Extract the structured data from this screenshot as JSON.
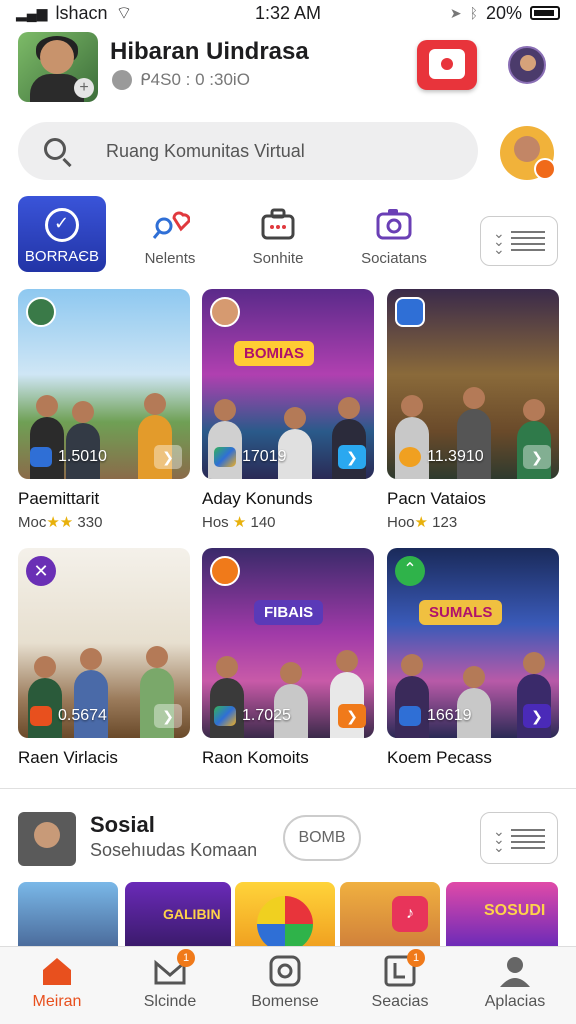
{
  "status_bar": {
    "carrier": "lshacn",
    "time": "1:32 AM",
    "battery": "20%"
  },
  "header": {
    "title": "Hibaran Uindrasa",
    "subtitle": "ᑭ4S0 : 0 :30iO"
  },
  "search": {
    "placeholder": "Ruang Komunitas Virtual"
  },
  "categories": [
    {
      "label": "BORRAЄB",
      "icon": "check-circle-icon",
      "active": true
    },
    {
      "label": "Nelents",
      "icon": "heart-pin-icon",
      "active": false
    },
    {
      "label": "Sonhite",
      "icon": "briefcase-icon",
      "active": false
    },
    {
      "label": "Sociatans",
      "icon": "camera-icon",
      "active": false
    }
  ],
  "cards": [
    {
      "title": "Paemittarit",
      "sub_prefix": "Moc",
      "rating": "★★",
      "sub_value": "330",
      "count": "1.5010",
      "sign": ""
    },
    {
      "title": "Aday Konunds",
      "sub_prefix": "Hos",
      "rating": "★",
      "sub_value": "140",
      "count": "17019",
      "sign": "BOMIAS"
    },
    {
      "title": "Pacn Vataios",
      "sub_prefix": "Hoo",
      "rating": "★",
      "sub_value": "123",
      "count": "11.3910",
      "sign": ""
    },
    {
      "title": "Raen Virlacis",
      "sub_prefix": "",
      "rating": "",
      "sub_value": "",
      "count": "0.5674",
      "sign": ""
    },
    {
      "title": "Raon Komoits",
      "sub_prefix": "",
      "rating": "",
      "sub_value": "",
      "count": "1.7025",
      "sign": "FIBAIS"
    },
    {
      "title": "Koem Pecass",
      "sub_prefix": "",
      "rating": "",
      "sub_value": "",
      "count": "16619",
      "sign": "SUMALS"
    }
  ],
  "sosial": {
    "title": "Sosial",
    "subtitle": "Sosehıudas Komaan",
    "button": "BOMB"
  },
  "strip": {
    "label_1": "GALIBIN",
    "label_2": "SOSUDI"
  },
  "tabs": [
    {
      "label": "Meiran",
      "icon": "home-icon",
      "active": true,
      "badge": ""
    },
    {
      "label": "Slcinde",
      "icon": "mail-icon",
      "active": false,
      "badge": "1"
    },
    {
      "label": "Bomense",
      "icon": "settings-icon",
      "active": false,
      "badge": ""
    },
    {
      "label": "Seacias",
      "icon": "document-icon",
      "active": false,
      "badge": "1"
    },
    {
      "label": "Aplacias",
      "icon": "person-icon",
      "active": false,
      "badge": ""
    }
  ],
  "colors": {
    "accent": "#e8501e",
    "brand_blue": "#2f45c8",
    "camera_red": "#e8343b"
  }
}
